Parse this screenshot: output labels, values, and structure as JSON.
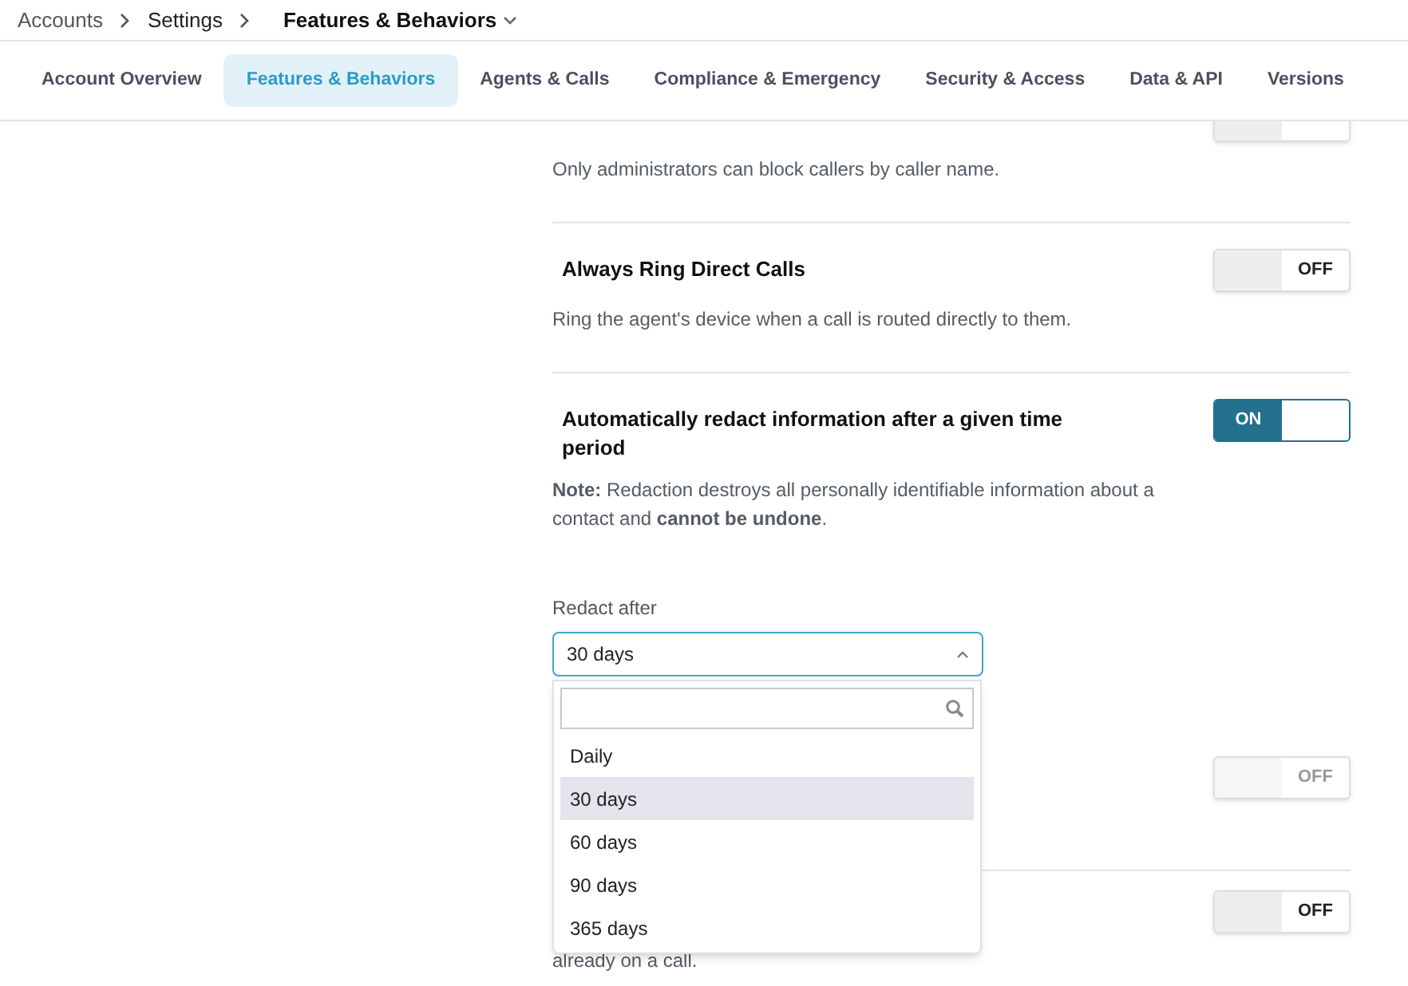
{
  "breadcrumb": [
    {
      "label": "Accounts",
      "current": false
    },
    {
      "label": "Settings",
      "current": false
    },
    {
      "label": "Features & Behaviors",
      "current": true
    }
  ],
  "tabs": [
    {
      "label": "Account Overview",
      "selected": false
    },
    {
      "label": "Features & Behaviors",
      "selected": true
    },
    {
      "label": "Agents & Calls",
      "selected": false
    },
    {
      "label": "Compliance & Emergency",
      "selected": false
    },
    {
      "label": "Security & Access",
      "selected": false
    },
    {
      "label": "Data & API",
      "selected": false
    },
    {
      "label": "Versions",
      "selected": false
    }
  ],
  "items": [
    {
      "kind": "setting",
      "description": "Only administrators can block callers by caller name.",
      "toggle": {
        "on": false
      }
    },
    {
      "kind": "setting",
      "title": "Always Ring Direct Calls",
      "description": "Ring the agent's device when a call is routed directly to them.",
      "toggle": {
        "on": false,
        "label": "OFF"
      }
    },
    {
      "kind": "setting",
      "title": "Automatically redact information after a given time period",
      "description": "**Note:** Redaction destroys all personally identifiable information about a contact and **cannot be undone**.",
      "toggle": {
        "on": true,
        "label": "ON"
      }
    },
    {
      "kind": "select",
      "label": "Redact after",
      "value": "30 days",
      "expanded": true,
      "options": [
        {
          "label": "Daily",
          "selected": false
        },
        {
          "label": "30 days",
          "selected": true
        },
        {
          "label": "60 days",
          "selected": false
        },
        {
          "label": "90 days",
          "selected": false
        },
        {
          "label": "365 days",
          "selected": false
        }
      ]
    },
    {
      "kind": "setting",
      "toggle": {
        "on": false,
        "disabled": true,
        "label": "OFF"
      }
    },
    {
      "kind": "setting",
      "description": "already on a call.",
      "toggle": {
        "on": false,
        "label": "OFF"
      }
    }
  ]
}
